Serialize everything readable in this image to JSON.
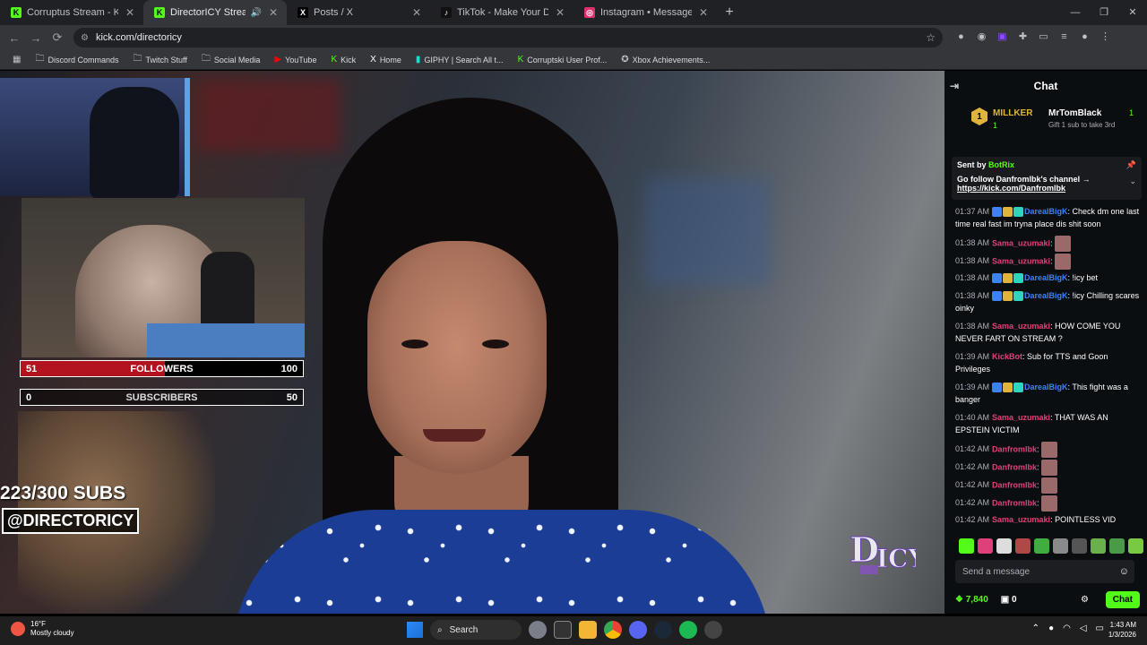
{
  "browser": {
    "tabs": [
      {
        "title": "Corruptus Stream - Kick Dashb",
        "favicon": "kick-icon",
        "active": false
      },
      {
        "title": "DirectorICY Stream - Watc",
        "favicon": "kick-icon",
        "active": true,
        "audio": true
      },
      {
        "title": "Posts / X",
        "favicon": "x-icon",
        "active": false
      },
      {
        "title": "TikTok - Make Your Day",
        "favicon": "tiktok-icon",
        "active": false
      },
      {
        "title": "Instagram • Messages",
        "favicon": "instagram-icon",
        "active": false
      }
    ],
    "new_tab": "+",
    "url": "kick.com/directoricy",
    "bookmarks": [
      {
        "label": "Discord Commands",
        "icon": "folder-icon"
      },
      {
        "label": "Twitch Stuff",
        "icon": "folder-icon"
      },
      {
        "label": "Social Media",
        "icon": "folder-icon"
      },
      {
        "label": "YouTube",
        "icon": "youtube-icon"
      },
      {
        "label": "Kick",
        "icon": "kick-icon"
      },
      {
        "label": "Home",
        "icon": "x-icon"
      },
      {
        "label": "GIPHY | Search All t...",
        "icon": "giphy-icon"
      },
      {
        "label": "Corruptski User Prof...",
        "icon": "kick-icon"
      },
      {
        "label": "Xbox Achievements...",
        "icon": "xbox-icon"
      }
    ]
  },
  "stream": {
    "followers": {
      "label": "FOLLOWERS",
      "current": "51",
      "goal": "100",
      "fraction": 0.51
    },
    "subscribers": {
      "label": "SUBSCRIBERS",
      "current": "0",
      "goal": "50",
      "fraction": 0.0
    },
    "subs_goal_text": "223/300 SUBS",
    "handle": "@DIRECTORICY"
  },
  "chat": {
    "title": "Chat",
    "leaderboard": {
      "rank": "1",
      "first_name": "MILLKER",
      "first_count": "1",
      "second_name": "MrTomBlack",
      "second_count": "1",
      "gift_text": "Gift 1 sub to take 3rd"
    },
    "pinned": {
      "sent_by": "Sent by",
      "bot": "BotRix",
      "message": "Go follow Danfromlbk's channel →",
      "link": "https://kick.com/Danfromlbk"
    },
    "messages": [
      {
        "time": "01:37 AM",
        "user": "DarealBigK",
        "color": "#3b82f6",
        "text": ": Check dm one last time real fast im tryna place dis shit soon"
      },
      {
        "time": "01:38 AM",
        "user": "Sama_uzumaki",
        "color": "#e0407a",
        "text": ":",
        "emote": true
      },
      {
        "time": "01:38 AM",
        "user": "Sama_uzumaki",
        "color": "#e0407a",
        "text": ":",
        "emote": true
      },
      {
        "time": "01:38 AM",
        "user": "DarealBigK",
        "color": "#3b82f6",
        "text": ": !icy bet"
      },
      {
        "time": "01:38 AM",
        "user": "DarealBigK",
        "color": "#3b82f6",
        "text": ": !icy Chilling scares oinky"
      },
      {
        "time": "01:38 AM",
        "user": "Sama_uzumaki",
        "color": "#e0407a",
        "text": ": HOW COME YOU NEVER FART ON STREAM ?"
      },
      {
        "time": "01:39 AM",
        "user": "KickBot",
        "color": "#e0407a",
        "text": ": Sub for TTS and Goon Privileges"
      },
      {
        "time": "01:39 AM",
        "user": "DarealBigK",
        "color": "#3b82f6",
        "text": ": This fight was a banger"
      },
      {
        "time": "01:40 AM",
        "user": "Sama_uzumaki",
        "color": "#e0407a",
        "text": ": THAT WAS AN EPSTEIN VICTIM"
      },
      {
        "time": "01:42 AM",
        "user": "Danfromlbk",
        "color": "#e0407a",
        "text": ":",
        "emote": true
      },
      {
        "time": "01:42 AM",
        "user": "Danfromlbk",
        "color": "#e0407a",
        "text": ":",
        "emote": true
      },
      {
        "time": "01:42 AM",
        "user": "Danfromlbk",
        "color": "#e0407a",
        "text": ":",
        "emote": true
      },
      {
        "time": "01:42 AM",
        "user": "Danfromlbk",
        "color": "#e0407a",
        "text": ":",
        "emote": true
      },
      {
        "time": "01:42 AM",
        "user": "Sama_uzumaki",
        "color": "#e0407a",
        "text": ": POINTLESS VID"
      }
    ],
    "input_placeholder": "Send a message",
    "points": "7,840",
    "count": "0",
    "send_label": "Chat",
    "accent": "#53fc18"
  },
  "taskbar": {
    "temp": "16°F",
    "weather": "Mostly cloudy",
    "search_label": "Search",
    "time": "1:43 AM",
    "date": "1/3/2026"
  }
}
